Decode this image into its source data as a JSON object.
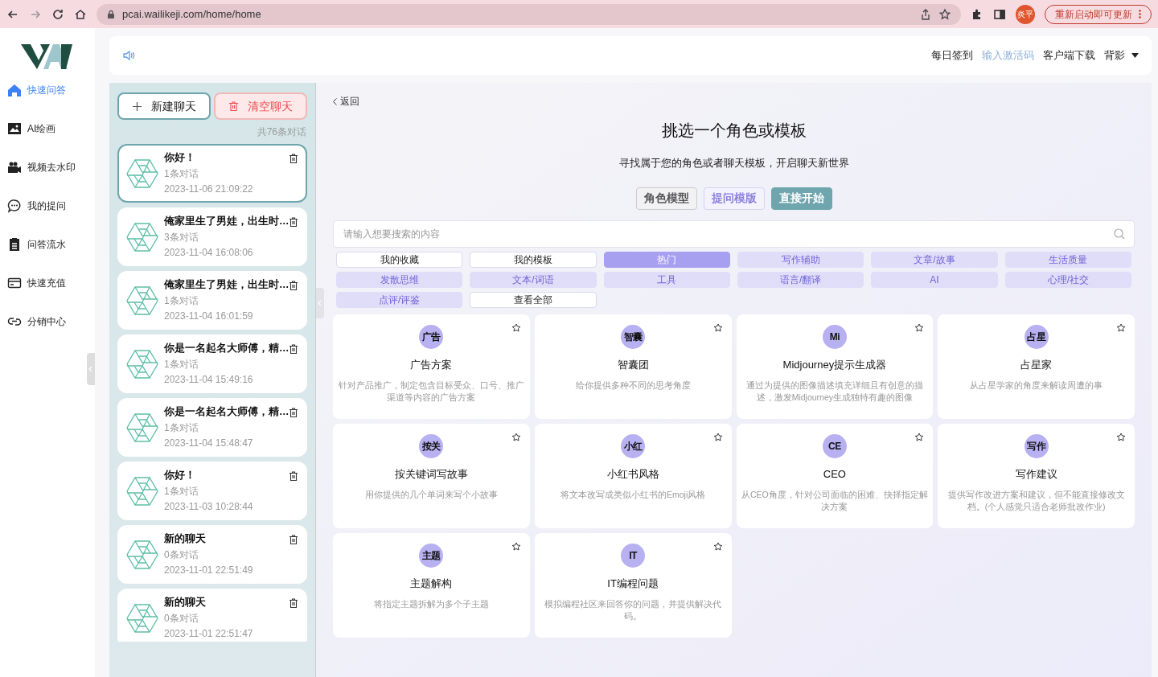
{
  "browser": {
    "url": "pcai.wailikeji.com/home/home",
    "profile": "炎平",
    "update_button": "重新启动即可更新"
  },
  "sidebar": {
    "items": [
      {
        "label": "快速问答",
        "selected": true
      },
      {
        "label": "AI绘画",
        "selected": false
      },
      {
        "label": "视频去水印",
        "selected": false
      },
      {
        "label": "我的提问",
        "selected": false
      },
      {
        "label": "问答流水",
        "selected": false
      },
      {
        "label": "快速充值",
        "selected": false
      },
      {
        "label": "分销中心",
        "selected": false
      }
    ]
  },
  "header": {
    "links": [
      {
        "label": "每日签到",
        "dimmed": false,
        "dropdown": false
      },
      {
        "label": "输入激活码",
        "dimmed": true,
        "dropdown": false
      },
      {
        "label": "客户端下载",
        "dimmed": false,
        "dropdown": false
      },
      {
        "label": "背影",
        "dimmed": false,
        "dropdown": true
      }
    ]
  },
  "chat_panel": {
    "new_button": "新建聊天",
    "clear_button": "清空聊天",
    "count": "共76条对话",
    "chats": [
      {
        "title": "你好！",
        "messages": "1条对话",
        "time": "2023-11-06 21:09:22",
        "selected": true
      },
      {
        "title": "俺家里生了男娃，出生时…",
        "messages": "3条对话",
        "time": "2023-11-04 16:08:06",
        "selected": false
      },
      {
        "title": "俺家里生了男娃，出生时…",
        "messages": "1条对话",
        "time": "2023-11-04 16:01:59",
        "selected": false
      },
      {
        "title": "你是一名起名大师傅，精…",
        "messages": "1条对话",
        "time": "2023-11-04 15:49:16",
        "selected": false
      },
      {
        "title": "你是一名起名大师傅，精…",
        "messages": "1条对话",
        "time": "2023-11-04 15:48:47",
        "selected": false
      },
      {
        "title": "你好！",
        "messages": "1条对话",
        "time": "2023-11-03 10:28:44",
        "selected": false
      },
      {
        "title": "新的聊天",
        "messages": "0条对话",
        "time": "2023-11-01 22:51:49",
        "selected": false
      },
      {
        "title": "新的聊天",
        "messages": "0条对话",
        "time": "2023-11-01 22:51:47",
        "selected": false
      }
    ]
  },
  "main": {
    "back": "返回",
    "title": "挑选一个角色或模板",
    "subtitle": "寻找属于您的角色或者聊天模板，开启聊天新世界",
    "modes": [
      {
        "label": "角色模型",
        "kind": "neutral",
        "selected": false
      },
      {
        "label": "提问模版",
        "kind": "accent",
        "selected": false
      },
      {
        "label": "直接开始",
        "selected": true
      }
    ],
    "search": {
      "placeholder": "请输入想要搜索的内容"
    },
    "tags": [
      {
        "label": "我的收藏",
        "kind": "plain",
        "selected": false
      },
      {
        "label": "我的模板",
        "kind": "plain",
        "selected": false
      },
      {
        "label": "热门",
        "kind": "category",
        "selected": true
      },
      {
        "label": "写作辅助",
        "kind": "category",
        "selected": false
      },
      {
        "label": "文章/故事",
        "kind": "category",
        "selected": false
      },
      {
        "label": "生活质量",
        "kind": "category",
        "selected": false
      },
      {
        "label": "发散思维",
        "kind": "category",
        "selected": false
      },
      {
        "label": "文本/词语",
        "kind": "category",
        "selected": false
      },
      {
        "label": "工具",
        "kind": "category",
        "selected": false
      },
      {
        "label": "语言/翻译",
        "kind": "category",
        "selected": false
      },
      {
        "label": "AI",
        "kind": "category",
        "selected": false
      },
      {
        "label": "心理/社交",
        "kind": "category",
        "selected": false
      },
      {
        "label": "点评/评鉴",
        "kind": "category",
        "selected": false
      },
      {
        "label": "查看全部",
        "kind": "plain",
        "selected": false
      }
    ],
    "templates": [
      {
        "badge": "广告",
        "title": "广告方案",
        "description": "针对产品推广，制定包含目标受众、口号、推广渠道等内容的广告方案",
        "favorite": false
      },
      {
        "badge": "智囊",
        "title": "智囊团",
        "description": "给你提供多种不同的思考角度",
        "favorite": false
      },
      {
        "badge": "Mi",
        "title": "Midjourney提示生成器",
        "description": "通过为提供的图像描述填充详细且有创意的描述，激发Midjourney生成独特有趣的图像",
        "favorite": false
      },
      {
        "badge": "占星",
        "title": "占星家",
        "description": "从占星学家的角度来解读周遭的事",
        "favorite": false
      },
      {
        "badge": "按关",
        "title": "按关键词写故事",
        "description": "用你提供的几个单词来写个小故事",
        "favorite": false
      },
      {
        "badge": "小红",
        "title": "小红书风格",
        "description": "将文本改写成类似小红书的Emoji风格",
        "favorite": false
      },
      {
        "badge": "CE",
        "title": "CEO",
        "description": "从CEO角度，针对公司面临的困难、抉择指定解决方案",
        "favorite": false
      },
      {
        "badge": "写作",
        "title": "写作建议",
        "description": "提供写作改进方案和建议，但不能直接修改文档。(个人感觉只适合老师批改作业)",
        "favorite": false
      },
      {
        "badge": "主题",
        "title": "主题解构",
        "description": "将指定主题拆解为多个子主题",
        "favorite": false
      },
      {
        "badge": "IT",
        "title": "IT编程问题",
        "description": "模拟编程社区来回答你的问题，并提供解决代码。",
        "favorite": false
      }
    ]
  }
}
